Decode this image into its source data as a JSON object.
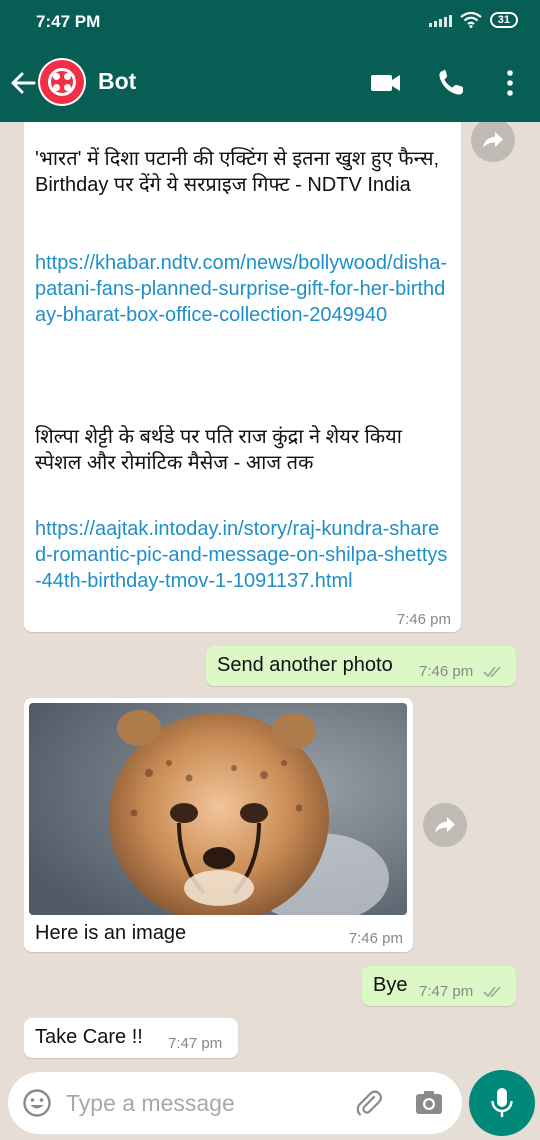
{
  "status_bar": {
    "time": "7:47 PM",
    "battery": "31"
  },
  "header": {
    "contact_name": "Bot"
  },
  "messages": [
    {
      "type": "incoming",
      "headline_1": "'भारत' में दिशा पटानी की एक्टिंग से इतना खुश हुए फैन्स, Birthday पर देंगे ये सरप्राइज गिफ्ट - NDTV India",
      "link_1": "https://khabar.ndtv.com/news/bollywood/disha-patani-fans-planned-surprise-gift-for-her-birthday-bharat-box-office-collection-2049940",
      "headline_2": "शिल्पा शेट्टी के बर्थडे पर पति राज कुंद्रा ने शेयर किया स्पेशल और रोमांटिक मैसेज - आज तक",
      "link_2": "https://aajtak.intoday.in/story/raj-kundra-shared-romantic-pic-and-message-on-shilpa-shettys-44th-birthday-tmov-1-1091137.html",
      "time": "7:46 pm"
    },
    {
      "type": "outgoing",
      "text": "Send another photo",
      "time": "7:46 pm"
    },
    {
      "type": "incoming",
      "image": "cheetah-cub-photo",
      "caption": "Here is an image",
      "time": "7:46 pm"
    },
    {
      "type": "outgoing",
      "text": "Bye",
      "time": "7:47 pm"
    },
    {
      "type": "incoming",
      "text": "Take Care !!",
      "time": "7:47 pm"
    }
  ],
  "composer": {
    "placeholder": "Type a message"
  },
  "icons": [
    "back-arrow-icon",
    "twilio-logo-icon",
    "video-call-icon",
    "phone-icon",
    "more-options-icon",
    "forward-icon",
    "emoji-icon",
    "attach-icon",
    "camera-icon",
    "mic-icon",
    "double-check-icon",
    "wifi-icon",
    "signal-icon"
  ],
  "colors": {
    "header": "#075e54",
    "outgoing_bubble": "#dcf8c6",
    "incoming_bubble": "#ffffff",
    "link": "#1f8fc7",
    "mic_button": "#00897b",
    "avatar": "#f22f46"
  }
}
